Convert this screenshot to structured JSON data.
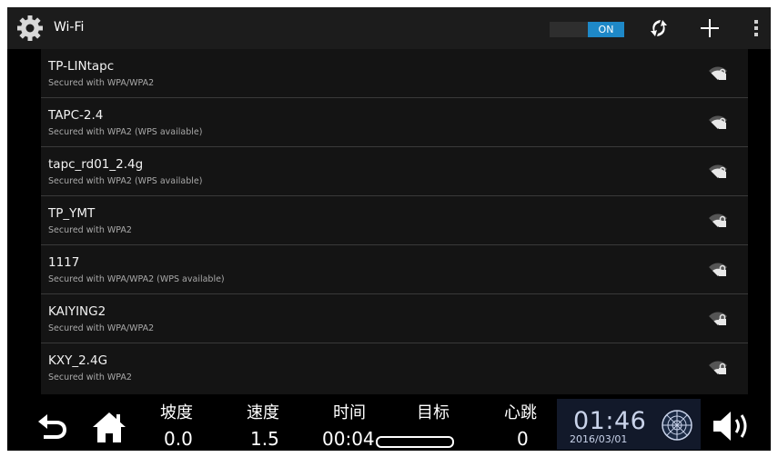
{
  "header": {
    "title": "Wi-Fi",
    "toggle_state": "ON",
    "icons": [
      "settings-gear-icon",
      "wps-scan-icon",
      "add-icon",
      "overflow-menu-icon"
    ]
  },
  "networks": [
    {
      "ssid": "TP-LINtapc",
      "security": "Secured with WPA/WPA2"
    },
    {
      "ssid": "TAPC-2.4",
      "security": "Secured with WPA2 (WPS available)"
    },
    {
      "ssid": "tapc_rd01_2.4g",
      "security": "Secured with WPA2 (WPS available)"
    },
    {
      "ssid": "TP_YMT",
      "security": "Secured with WPA2"
    },
    {
      "ssid": "1117",
      "security": "Secured with WPA/WPA2 (WPS available)"
    },
    {
      "ssid": "KAIYING2",
      "security": "Secured with WPA/WPA2"
    },
    {
      "ssid": "KXY_2.4G",
      "security": "Secured with WPA2"
    }
  ],
  "footer": {
    "incline": {
      "label": "坡度",
      "value": "0.0"
    },
    "speed": {
      "label": "速度",
      "value": "1.5"
    },
    "time": {
      "label": "时间",
      "value": "00:04"
    },
    "target": {
      "label": "目标"
    },
    "heart": {
      "label": "心跳",
      "value": "0"
    },
    "clock": {
      "time": "01:46",
      "date": "2016/03/01"
    },
    "icons": [
      "back-icon",
      "home-icon",
      "globe-icon",
      "volume-icon"
    ]
  },
  "colors": {
    "accent": "#1e88c7",
    "background": "#000000",
    "list_bg": "#141414"
  }
}
